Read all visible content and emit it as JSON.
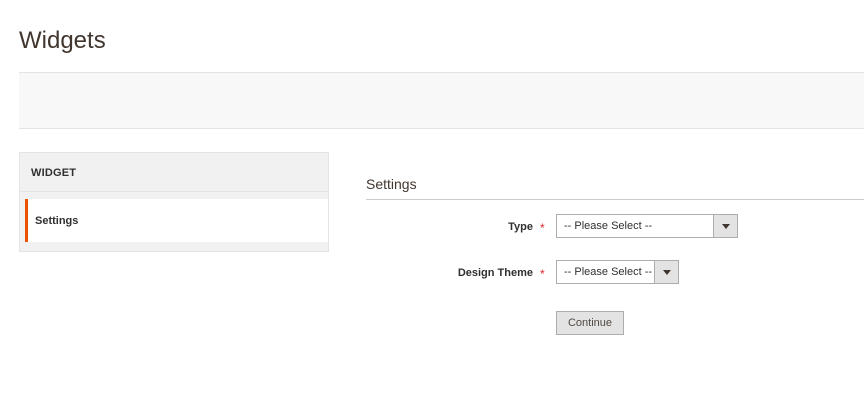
{
  "page": {
    "title": "Widgets"
  },
  "sidebar": {
    "title": "WIDGET",
    "tabs": [
      {
        "label": "Settings",
        "active": true
      }
    ]
  },
  "settings": {
    "title": "Settings",
    "fields": [
      {
        "label": "Type",
        "required": true,
        "value": "-- Please Select --"
      },
      {
        "label": "Design Theme",
        "required": true,
        "value": "-- Please Select --"
      }
    ],
    "required_marker": "*",
    "continue_label": "Continue"
  },
  "colors": {
    "accent": "#eb5202",
    "required": "#e22626",
    "button_bg": "#e3e3e3"
  },
  "icons": {
    "select_arrow": "chevron-down-icon"
  }
}
